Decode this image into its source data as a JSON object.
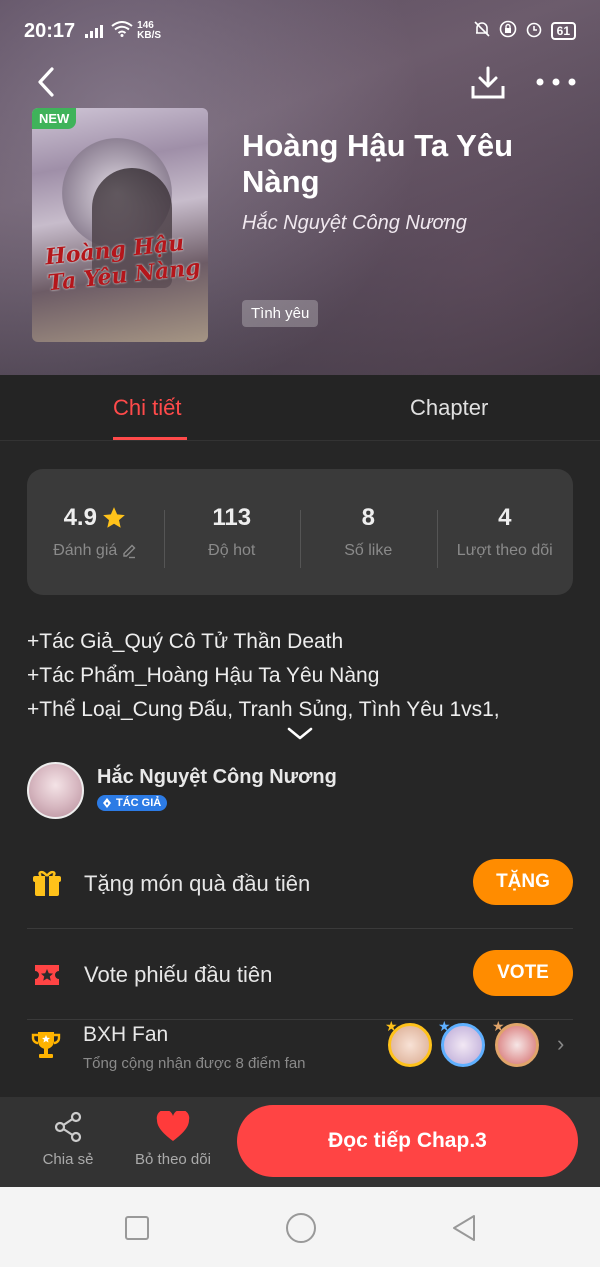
{
  "status_bar": {
    "time": "20:17",
    "speed": "146",
    "speed_unit": "KB/S",
    "battery": "61"
  },
  "header": {
    "new_badge": "NEW",
    "cover_title": "Hoàng Hậu Ta Yêu Nàng",
    "title": "Hoàng Hậu Ta Yêu Nàng",
    "author": "Hắc Nguyệt Công Nương",
    "genre": "Tình yêu"
  },
  "tabs": {
    "detail": "Chi tiết",
    "chapter": "Chapter"
  },
  "stats": [
    {
      "value": "4.9",
      "label": "Đánh giá"
    },
    {
      "value": "113",
      "label": "Độ hot"
    },
    {
      "value": "8",
      "label": "Số like"
    },
    {
      "value": "4",
      "label": "Lượt theo dõi"
    }
  ],
  "description": [
    "+Tác Giả_Quý Cô Tử Thần Death",
    "+Tác Phẩm_Hoàng Hậu Ta Yêu Nàng",
    "+Thể Loại_Cung Đấu, Tranh Sủng, Tình Yêu 1vs1,"
  ],
  "author_card": {
    "name": "Hắc Nguyệt Công Nương",
    "badge": "TÁC GIẢ"
  },
  "actions": [
    {
      "label": "Tặng món quà đầu tiên",
      "button": "TẶNG"
    },
    {
      "label": "Vote phiếu đầu tiên",
      "button": "VOTE"
    }
  ],
  "fan": {
    "title": "BXH Fan",
    "subtitle": "Tổng cộng nhận được 8 điểm fan"
  },
  "bottom_bar": {
    "share": "Chia sẻ",
    "unfollow": "Bỏ theo dõi",
    "read": "Đọc tiếp Chap.3"
  },
  "colors": {
    "accent": "#ff4a4a",
    "orange": "#ff8c00",
    "badge_new": "#3fb35a",
    "author_badge": "#2c7be5"
  }
}
